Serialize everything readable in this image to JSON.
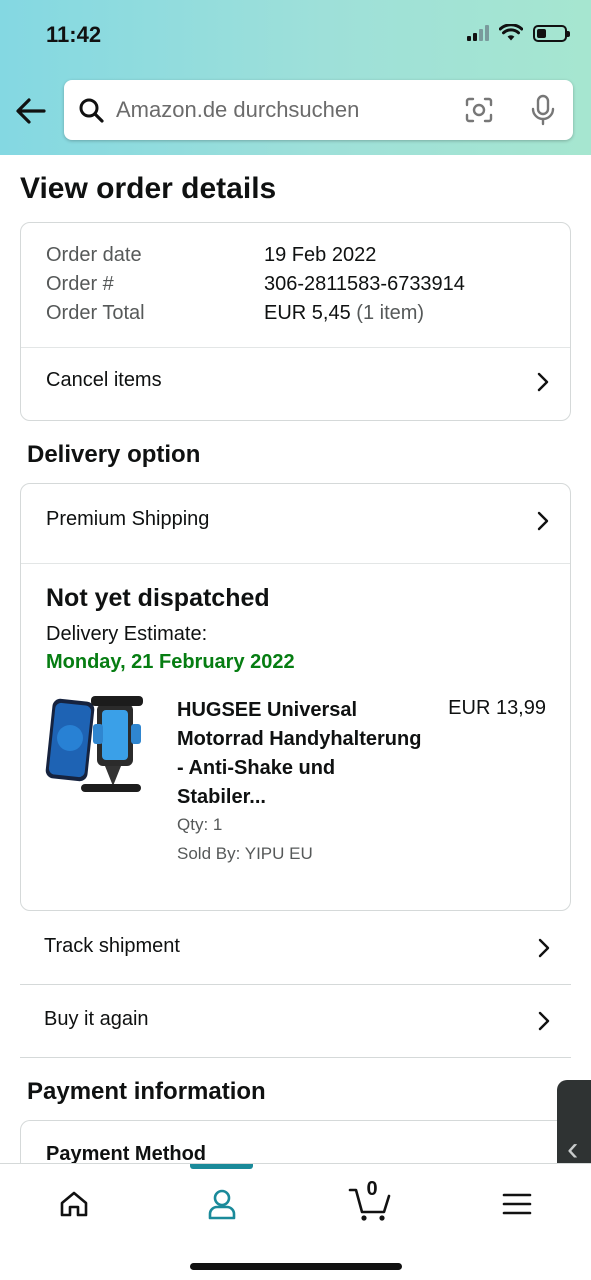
{
  "status_bar": {
    "time": "11:42"
  },
  "search": {
    "placeholder": "Amazon.de durchsuchen"
  },
  "page": {
    "title": "View order details"
  },
  "order_summary": {
    "rows": [
      {
        "label": "Order date",
        "value": "19 Feb 2022"
      },
      {
        "label": "Order #",
        "value": "306-2811583-6733914"
      },
      {
        "label": "Order Total",
        "value": "EUR 5,45",
        "extra": "(1 item)"
      }
    ],
    "cancel_label": "Cancel items"
  },
  "delivery": {
    "section_title": "Delivery option",
    "shipping_label": "Premium Shipping",
    "status": "Not yet dispatched",
    "estimate_label": "Delivery Estimate:",
    "estimate_date": "Monday, 21 February 2022",
    "estimate_color": "#067d12",
    "product": {
      "name": "HUGSEE Universal Motorrad Handyhalterung - Anti-Shake und Stabiler...",
      "price": "EUR 13,99",
      "qty": "Qty: 1",
      "seller": "Sold By: YIPU EU"
    }
  },
  "actions": {
    "track_label": "Track shipment",
    "buy_again_label": "Buy it again"
  },
  "payment": {
    "section_title": "Payment information",
    "method_label": "Payment Method"
  },
  "bottom_nav": {
    "items": [
      {
        "icon": "home-icon"
      },
      {
        "icon": "account-icon",
        "active": true
      },
      {
        "icon": "cart-icon",
        "count": "0"
      },
      {
        "icon": "menu-icon"
      }
    ],
    "accent_color": "#1a8a9a"
  }
}
